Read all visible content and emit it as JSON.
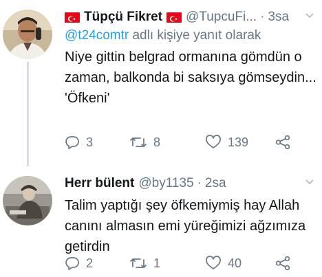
{
  "tweets": [
    {
      "name": "Tüpçü Fikret",
      "handle": "@TupcuFi...",
      "time": "3sa",
      "reply_prefix": "@t24comtr",
      "reply_suffix": " adlı kişiye yanıt olarak",
      "text": "Niye gittin belgrad ormanına gömdün o zaman, balkonda bi saksıya gömseydin...\n'Öfkeni'",
      "reply_count": "3",
      "retweet_count": "8",
      "like_count": "139"
    },
    {
      "name": "Herr bülent",
      "handle": "@by1135",
      "time": "2sa",
      "text": "Talim yaptığı şey öfkemiymiş hay Allah canını almasın emi yüreğimizi ağzımıza getirdin",
      "reply_count": "2",
      "retweet_count": "1",
      "like_count": "40"
    }
  ],
  "colors": {
    "accent": "#1da1f2",
    "secondary_text": "#657786",
    "flag_red": "#e30a17",
    "thread_line": "#d8dde2"
  },
  "icons": [
    "turkish-flag-icon",
    "chevron-down-icon",
    "reply-icon",
    "retweet-icon",
    "like-icon",
    "share-icon"
  ]
}
